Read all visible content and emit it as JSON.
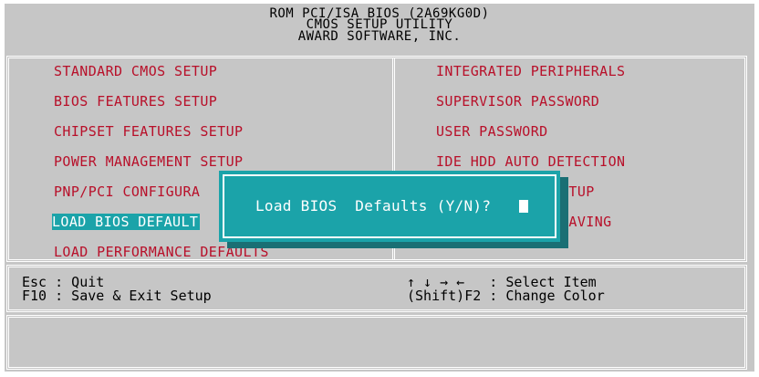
{
  "header": {
    "line1": "ROM PCI/ISA BIOS (2A69KG0D)",
    "line2": "CMOS SETUP UTILITY",
    "line3": "AWARD SOFTWARE, INC."
  },
  "menu": {
    "left": [
      "STANDARD CMOS SETUP",
      "BIOS FEATURES SETUP",
      "CHIPSET FEATURES SETUP",
      "POWER MANAGEMENT SETUP",
      "PNP/PCI CONFIGURA",
      "LOAD BIOS DEFAULT",
      "LOAD PERFORMANCE DEFAULTS"
    ],
    "right": [
      "INTEGRATED PERIPHERALS",
      "SUPERVISOR PASSWORD",
      "USER PASSWORD",
      "IDE HDD AUTO DETECTION",
      "ETUP",
      "SAVING"
    ],
    "selected_index": 5
  },
  "dialog": {
    "prompt": "Load BIOS  Defaults (Y/N)?"
  },
  "help": {
    "left_line1": "Esc : Quit",
    "left_line2": "F10 : Save & Exit Setup",
    "right_line1": "↑ ↓ → ←   : Select Item",
    "right_line2": "(Shift)F2 : Change Color"
  },
  "colors": {
    "background": "#c6c6c6",
    "menu_text": "#b8102a",
    "highlight": "#1ba3a9",
    "frame": "#ffffff"
  }
}
